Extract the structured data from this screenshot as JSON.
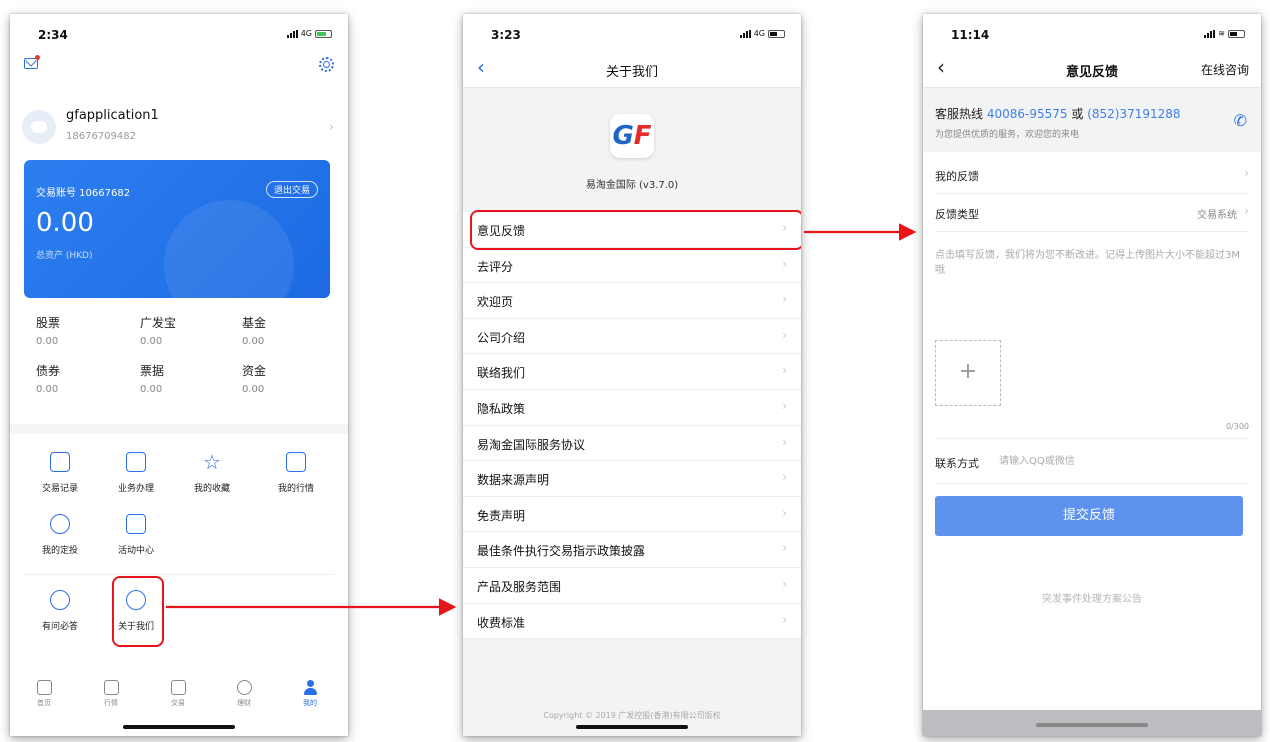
{
  "phone1": {
    "status_time": "2:34",
    "network": "4G",
    "user": {
      "name": "gfapplication1",
      "phone": "18676709482"
    },
    "account": {
      "label": "交易账号 10667682",
      "exit_label": "退出交易",
      "total": "0.00",
      "total_label": "总资产 (HKD)"
    },
    "assets": [
      {
        "name": "股票",
        "value": "0.00"
      },
      {
        "name": "广发宝",
        "value": "0.00"
      },
      {
        "name": "基金",
        "value": "0.00"
      },
      {
        "name": "债券",
        "value": "0.00"
      },
      {
        "name": "票据",
        "value": "0.00"
      },
      {
        "name": "资金",
        "value": "0.00"
      }
    ],
    "menu": [
      {
        "label": "交易记录",
        "icon": "list-icon"
      },
      {
        "label": "业务办理",
        "icon": "briefcase-icon"
      },
      {
        "label": "我的收藏",
        "icon": "star-icon"
      },
      {
        "label": "我的行情",
        "icon": "chart-icon"
      },
      {
        "label": "我的定投",
        "icon": "clock-icon"
      },
      {
        "label": "活动中心",
        "icon": "gift-icon"
      },
      {
        "label": "有问必答",
        "icon": "question-icon"
      },
      {
        "label": "关于我们",
        "icon": "info-icon"
      }
    ],
    "tabs": [
      {
        "label": "首页",
        "icon": "home-icon"
      },
      {
        "label": "行情",
        "icon": "bars-icon"
      },
      {
        "label": "交易",
        "icon": "trade-icon"
      },
      {
        "label": "理财",
        "icon": "wealth-icon"
      },
      {
        "label": "我的",
        "icon": "person-icon"
      }
    ]
  },
  "phone2": {
    "status_time": "3:23",
    "network": "4G",
    "title": "关于我们",
    "app_version": "易淘金国际 (v3.7.0)",
    "items": [
      "意见反馈",
      "去评分",
      "欢迎页",
      "公司介绍",
      "联络我们",
      "隐私政策",
      "易淘金国际服务协议",
      "数据来源声明",
      "免责声明",
      "最佳条件执行交易指示政策披露",
      "产品及服务范围",
      "收费标准"
    ],
    "copyright": "Copyright © 2019 广发控股(香港)有限公司版权"
  },
  "phone3": {
    "status_time": "11:14",
    "title": "意见反馈",
    "online_label": "在线咨询",
    "hotline": {
      "label": "客服热线",
      "number1": "40086-95575",
      "or_text": "或",
      "number2": "(852)37191288",
      "subtitle": "为您提供优质的服务，欢迎您的来电"
    },
    "my_feedback_label": "我的反馈",
    "feedback_type_label": "反馈类型",
    "feedback_type_value": "交易系统",
    "feedback_placeholder": "点击填写反馈，我们将为您不断改进。记得上传图片大小不能超过3M哦",
    "upload_plus": "+",
    "counter": "0/300",
    "contact_label": "联系方式",
    "contact_placeholder": "请输入QQ或微信",
    "submit_label": "提交反馈",
    "notice": "突发事件处理方案公告"
  },
  "colors": {
    "accent": "#2b6fe6",
    "highlight": "#e8141b",
    "submit": "#5d93ee"
  }
}
